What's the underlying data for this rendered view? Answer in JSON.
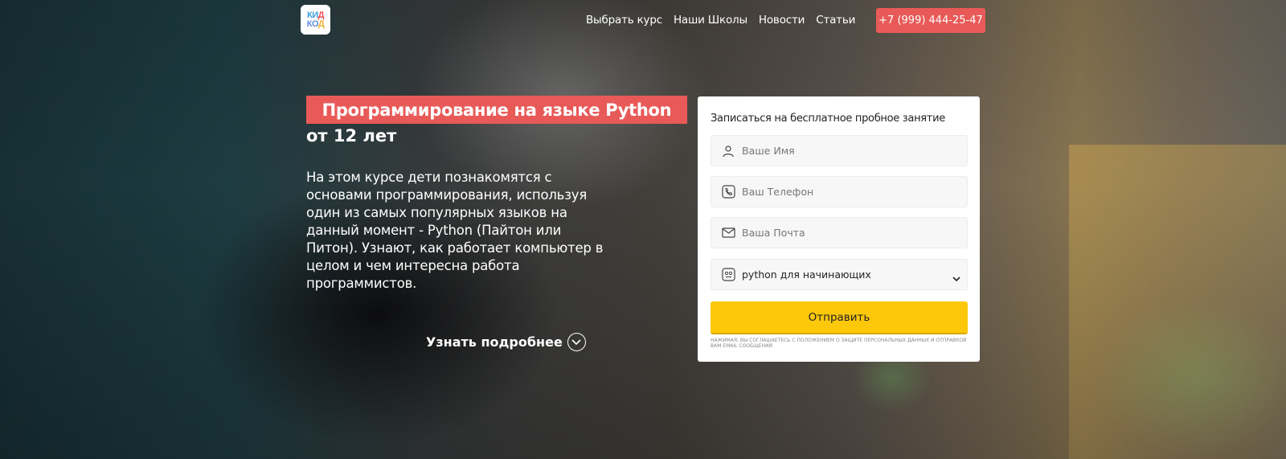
{
  "logo": {
    "line1_a": "КИ",
    "line1_b": "Д",
    "line2_a": "КО",
    "line2_b": "Д"
  },
  "nav": {
    "items": [
      "Выбрать курс",
      "Наши Школы",
      "Новости",
      "Статьи"
    ],
    "phone": "+7 (999) 444-25-47"
  },
  "hero": {
    "title": "Программирование на языке Python",
    "age": "от 12 лет",
    "description": "На этом курсе дети познакомятся с основами программирования, используя один из самых популярных языков на данный момент - Python (Пайтон или Питон). Узнают, как работает компьютер в целом и чем интересна работа программистов.",
    "more_label": "Узнать подробнее"
  },
  "form": {
    "title": "Записаться на бесплатное пробное занятие",
    "name_placeholder": "Ваше Имя",
    "phone_placeholder": "Ваш Телефон",
    "email_placeholder": "Ваша Почта",
    "course_selected": "python для начинающих",
    "submit_label": "Отправить",
    "consent": "Нажимая, вы соглашаетесь с положением о защите персональных данных и отправкой вам email сообщений"
  },
  "colors": {
    "accent": "#e85a58",
    "submit": "#fdc80a"
  },
  "icons": [
    "user-icon",
    "phone-icon",
    "mail-icon",
    "course-icon",
    "chevron-down-icon"
  ]
}
